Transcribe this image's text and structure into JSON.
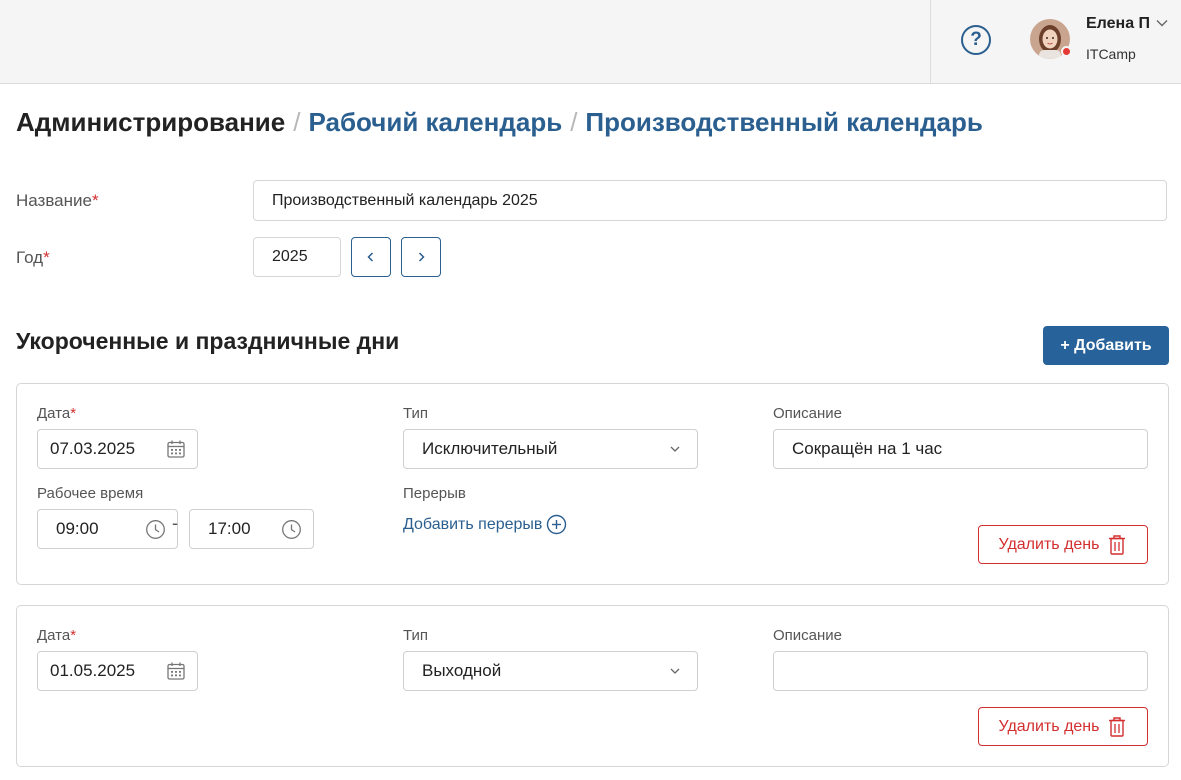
{
  "header": {
    "help_icon": "question-circle-icon",
    "user": {
      "name": "Елена П",
      "company": "ITCamp",
      "status_color": "#e53935"
    }
  },
  "breadcrumb": {
    "root": "Администрирование",
    "separator": "/",
    "items": [
      "Рабочий календарь",
      "Производственный календарь"
    ]
  },
  "form": {
    "name_label": "Название",
    "name_value": "Производственный календарь 2025",
    "year_label": "Год",
    "year_value": "2025",
    "required_mark": "*"
  },
  "section": {
    "title": "Укороченные и праздничные дни",
    "add_button": "+ Добавить"
  },
  "days": [
    {
      "date_label": "Дата",
      "date_value": "07.03.2025",
      "type_label": "Тип",
      "type_value": "Исключительный",
      "description_label": "Описание",
      "description_value": "Сокращён на 1 час",
      "work_time_label": "Рабочее время",
      "time_from": "09:00",
      "time_separator": "-",
      "time_to": "17:00",
      "break_label": "Перерыв",
      "add_break": "Добавить перерыв",
      "delete_button": "Удалить день"
    },
    {
      "date_label": "Дата",
      "date_value": "01.05.2025",
      "type_label": "Тип",
      "type_value": "Выходной",
      "description_label": "Описание",
      "description_value": "",
      "delete_button": "Удалить день"
    }
  ],
  "colors": {
    "accent": "#27629a",
    "link": "#2a5f8f",
    "danger": "#d32f2f"
  }
}
